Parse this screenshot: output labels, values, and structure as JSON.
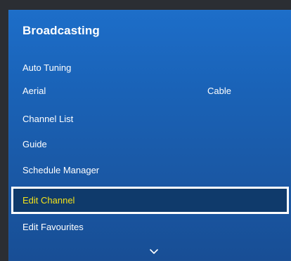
{
  "menu": {
    "title": "Broadcasting",
    "items": [
      {
        "label": "Auto Tuning",
        "value": ""
      },
      {
        "label": "Aerial",
        "value": "Cable"
      },
      {
        "label": "Channel List",
        "value": ""
      },
      {
        "label": "Guide",
        "value": ""
      },
      {
        "label": "Schedule Manager",
        "value": ""
      },
      {
        "label": "Edit Channel",
        "value": ""
      },
      {
        "label": "Edit Favourites",
        "value": ""
      }
    ],
    "selected_index": 5,
    "more_icon": "chevron-down-icon"
  },
  "colors": {
    "panel_blue": "#1a63b8",
    "selected_bg": "#0f3a6b",
    "selected_text": "#f2e21a",
    "focus_border": "#ffffff"
  }
}
